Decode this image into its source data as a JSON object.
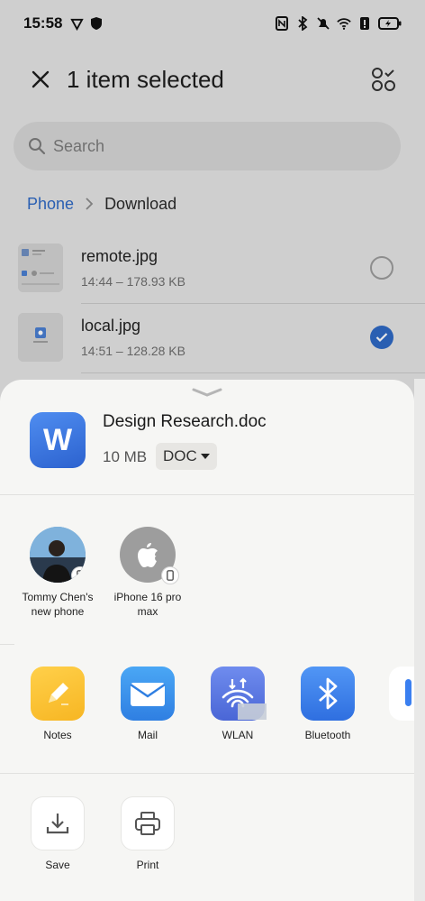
{
  "status_bar": {
    "time": "15:58"
  },
  "toolbar": {
    "title": "1 item selected"
  },
  "search": {
    "placeholder": "Search"
  },
  "breadcrumb": {
    "root": "Phone",
    "current": "Download"
  },
  "files": [
    {
      "name": "remote.jpg",
      "meta": "14:44 – 178.93 KB",
      "selected": false
    },
    {
      "name": "local.jpg",
      "meta": "14:51 – 128.28 KB",
      "selected": true
    }
  ],
  "share_sheet": {
    "document": {
      "icon_letter": "W",
      "title": "Design Research.doc",
      "size": "10 MB",
      "type": "DOC"
    },
    "contacts": [
      {
        "label_line1": "Tommy Chen's",
        "label_line2": "new phone"
      },
      {
        "label_line1": "iPhone 16 pro",
        "label_line2": "max"
      }
    ],
    "apps": [
      {
        "label": "Notes",
        "icon": "notes-icon"
      },
      {
        "label": "Mail",
        "icon": "mail-icon"
      },
      {
        "label": "WLAN",
        "icon": "wlan-icon"
      },
      {
        "label": "Bluetooth",
        "icon": "bluetooth-icon"
      }
    ],
    "actions": [
      {
        "label": "Save",
        "icon": "download-icon"
      },
      {
        "label": "Print",
        "icon": "printer-icon"
      }
    ]
  },
  "colors": {
    "accent": "#2f69c4",
    "sheet_background": "#f6f6f4",
    "dimmed_background": "#e4e4e4"
  }
}
